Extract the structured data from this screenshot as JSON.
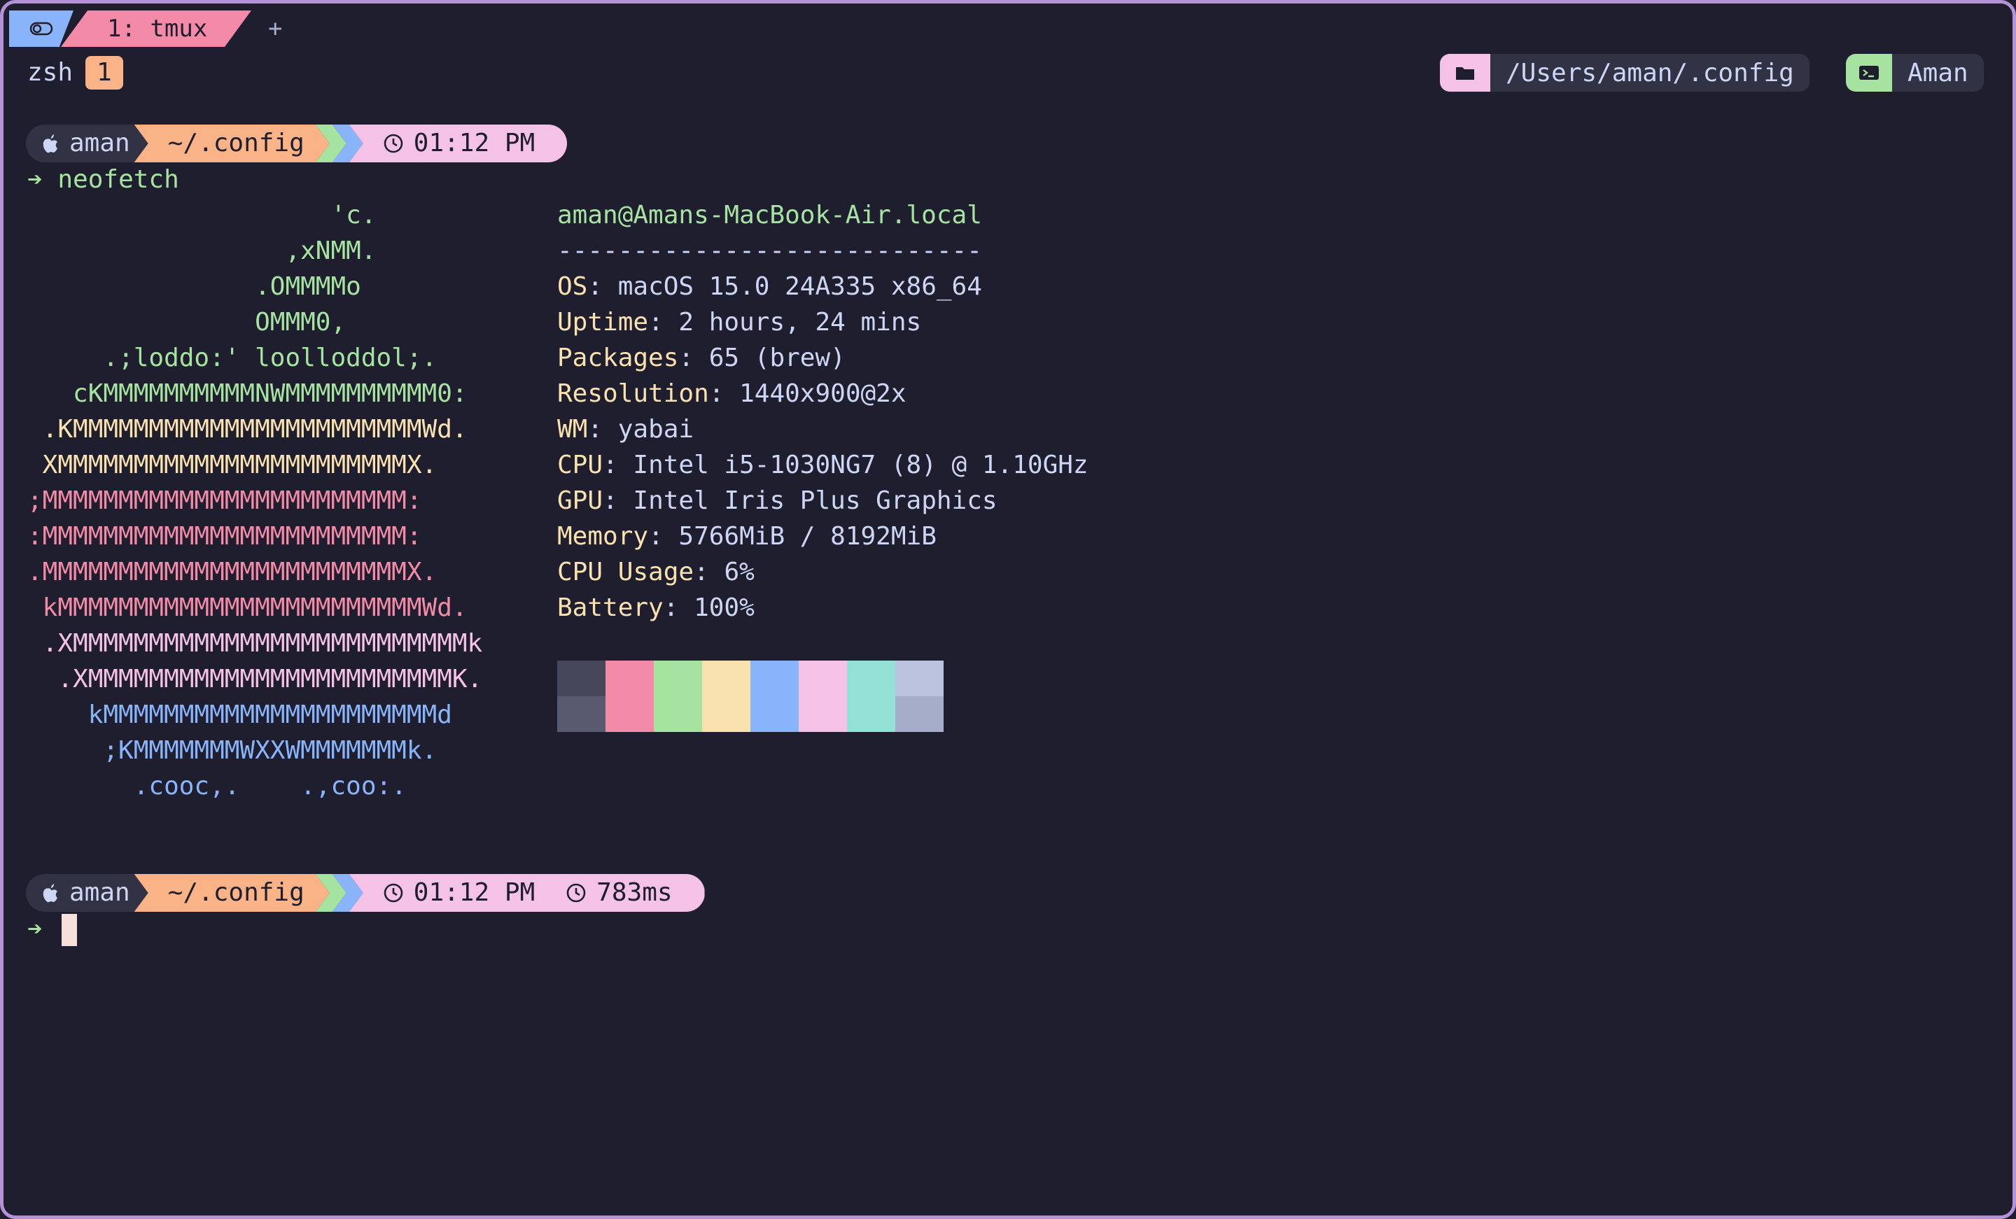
{
  "tmux": {
    "tab_icon": "toggle-icon",
    "window_label": "1: tmux",
    "new_window": "+",
    "session_name": "zsh",
    "session_count": "1",
    "status_path": "/Users/aman/.config",
    "status_user": "Aman"
  },
  "prompt1": {
    "user": "aman",
    "dir": "~/.config",
    "time": "01:12 PM",
    "arrow": "➔",
    "command": "neofetch"
  },
  "prompt2": {
    "user": "aman",
    "dir": "~/.config",
    "time": "01:12 PM",
    "duration": "783ms",
    "arrow": "➔"
  },
  "logo": [
    {
      "text": "                    'c.",
      "color": "green"
    },
    {
      "text": "                 ,xNMM.",
      "color": "green"
    },
    {
      "text": "               .OMMMMo",
      "color": "green"
    },
    {
      "text": "               OMMM0,",
      "color": "green"
    },
    {
      "text": "     .;loddo:' loolloddol;.",
      "color": "green"
    },
    {
      "text": "   cKMMMMMMMMMMNWMMMMMMMMMM0:",
      "color": "green"
    },
    {
      "text": " .KMMMMMMMMMMMMMMMMMMMMMMMWd.",
      "color": "yellow"
    },
    {
      "text": " XMMMMMMMMMMMMMMMMMMMMMMMX.",
      "color": "yellow"
    },
    {
      "text": ";MMMMMMMMMMMMMMMMMMMMMMMM:",
      "color": "red"
    },
    {
      "text": ":MMMMMMMMMMMMMMMMMMMMMMMM:",
      "color": "red"
    },
    {
      "text": ".MMMMMMMMMMMMMMMMMMMMMMMMX.",
      "color": "red"
    },
    {
      "text": " kMMMMMMMMMMMMMMMMMMMMMMMMWd.",
      "color": "red"
    },
    {
      "text": " .XMMMMMMMMMMMMMMMMMMMMMMMMMMk",
      "color": "pink"
    },
    {
      "text": "  .XMMMMMMMMMMMMMMMMMMMMMMMMK.",
      "color": "pink"
    },
    {
      "text": "    kMMMMMMMMMMMMMMMMMMMMMMd",
      "color": "blue"
    },
    {
      "text": "     ;KMMMMMMMWXXWMMMMMMMk.",
      "color": "blue"
    },
    {
      "text": "       .cooc,.    .,coo:.",
      "color": "blue"
    }
  ],
  "info": {
    "header": "aman@Amans-MacBook-Air.local",
    "separator": "----------------------------",
    "rows": [
      {
        "key": "OS",
        "value": "macOS 15.0 24A335 x86_64"
      },
      {
        "key": "Uptime",
        "value": "2 hours, 24 mins"
      },
      {
        "key": "Packages",
        "value": "65 (brew)"
      },
      {
        "key": "Resolution",
        "value": "1440x900@2x"
      },
      {
        "key": "WM",
        "value": "yabai"
      },
      {
        "key": "CPU",
        "value": "Intel i5-1030NG7 (8) @ 1.10GHz"
      },
      {
        "key": "GPU",
        "value": "Intel Iris Plus Graphics"
      },
      {
        "key": "Memory",
        "value": "5766MiB / 8192MiB"
      },
      {
        "key": "CPU Usage",
        "value": "6%"
      },
      {
        "key": "Battery",
        "value": "100%"
      }
    ]
  },
  "palette": {
    "top": [
      "#45475a",
      "#f38ba8",
      "#a6e3a1",
      "#f9e2af",
      "#89b4fa",
      "#f5c2e7",
      "#94e2d5",
      "#bac2de"
    ],
    "bottom": [
      "#585b70",
      "#f38ba8",
      "#a6e3a1",
      "#f9e2af",
      "#89b4fa",
      "#f5c2e7",
      "#94e2d5",
      "#a6adc8"
    ]
  },
  "colors": {
    "background": "#1e1e2e",
    "border": "#b392d6",
    "green": "#a6e3a1",
    "yellow": "#f9e2af",
    "peach": "#fab387",
    "pink": "#f5c2e7",
    "red": "#f38ba8",
    "blue": "#89b4fa"
  }
}
